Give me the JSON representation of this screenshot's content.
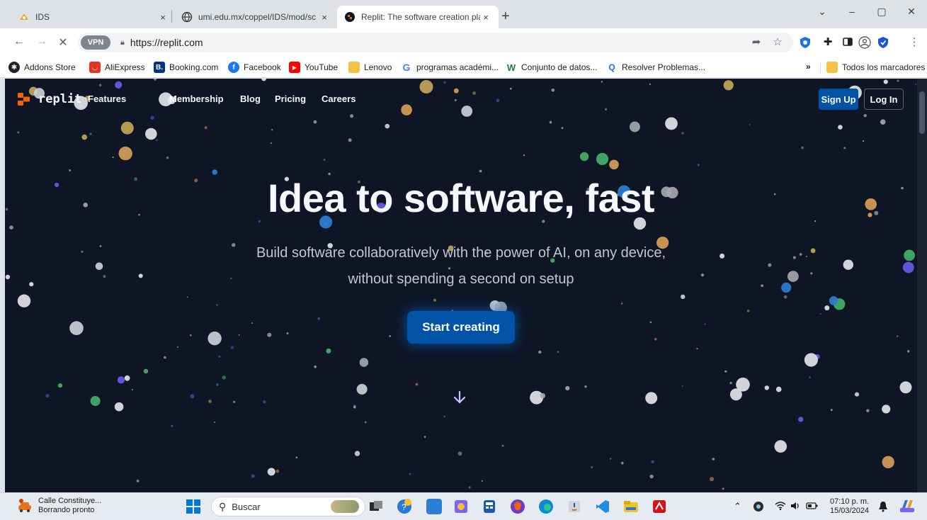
{
  "browser": {
    "tabs": [
      {
        "title": "IDS",
        "close": "×"
      },
      {
        "title": "umi.edu.mx/coppel/IDS/mod/sc",
        "close": "×"
      },
      {
        "title": "Replit: The software creation pla",
        "close": "×"
      }
    ],
    "new_tab": "+",
    "window_controls": {
      "dropdown": "⌄",
      "minimize": "–",
      "restore": "▢",
      "close": "✕"
    },
    "nav": {
      "back": "←",
      "forward": "→",
      "stop": "✕"
    },
    "vpn_badge": "VPN",
    "url": "https://replit.com",
    "bookmarks": [
      {
        "label": "Addons Store",
        "color": "#202124",
        "glyph": "✱"
      },
      {
        "label": "AliExpress",
        "color": "#e43225",
        "glyph": "◡"
      },
      {
        "label": "Booking.com",
        "color": "#003580",
        "glyph": "B."
      },
      {
        "label": "Facebook",
        "color": "#1877f2",
        "glyph": "f"
      },
      {
        "label": "YouTube",
        "color": "#ff0000",
        "glyph": "▶"
      },
      {
        "label": "Lenovo",
        "color": "#f4c142",
        "glyph": ""
      },
      {
        "label": "programas académi...",
        "color": "#ffffff",
        "glyph": "G"
      },
      {
        "label": "Conjunto de datos...",
        "color": "#ffffff",
        "glyph": "W"
      },
      {
        "label": "Resolver Problemas...",
        "color": "#ffffff",
        "glyph": "Q"
      }
    ],
    "bookmarks_overflow": "»",
    "all_bookmarks": "Todos los marcadores"
  },
  "replit": {
    "logo": "replit",
    "nav": [
      "Features",
      "Membership",
      "Blog",
      "Pricing",
      "Careers"
    ],
    "sign_up": "Sign Up",
    "log_in": "Log In",
    "hero_title": "Idea to software, fast",
    "hero_subtitle": "Build software collaboratively with the power of AI, on any device, without spending a second on setup",
    "cta": "Start creating",
    "colors": {
      "background": "#0e1525",
      "primary": "#0053a6",
      "logo_orange": "#f26207"
    }
  },
  "taskbar": {
    "weather_title": "Calle Constituye...",
    "weather_sub": "Borrando pronto",
    "search_placeholder": "Buscar",
    "time": "07:10 p. m.",
    "date": "15/03/2024"
  }
}
